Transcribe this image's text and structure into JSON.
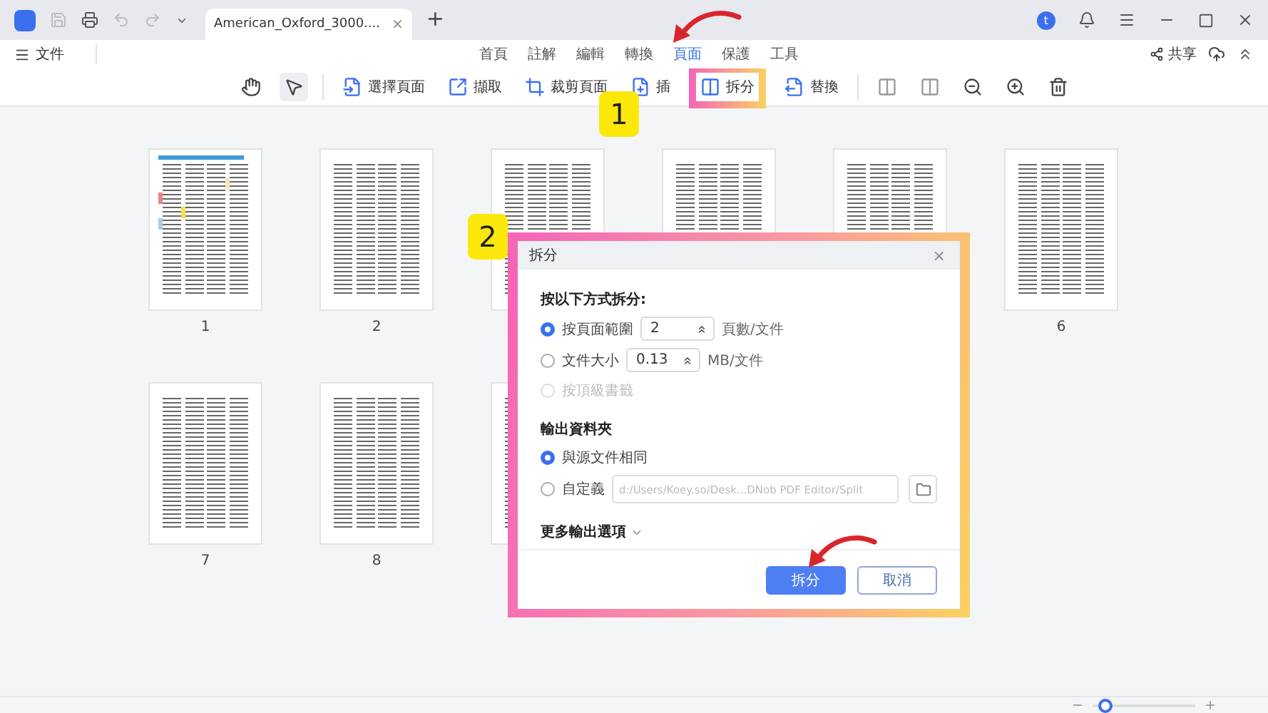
{
  "title_bar": {
    "avatar": "t",
    "tab": {
      "title": "American_Oxford_3000....",
      "close": "×"
    },
    "new_tab": "+"
  },
  "menu": {
    "file": "文件",
    "share": "共享"
  },
  "ribbon_tabs": [
    {
      "label": "首頁",
      "selected": false
    },
    {
      "label": "註解",
      "selected": false
    },
    {
      "label": "編輯",
      "selected": false
    },
    {
      "label": "轉換",
      "selected": false
    },
    {
      "label": "頁面",
      "selected": true
    },
    {
      "label": "保護",
      "selected": false
    },
    {
      "label": "工具",
      "selected": false
    }
  ],
  "toolbar": {
    "select_tool_selected": true,
    "buttons": [
      {
        "label": "選擇頁面",
        "highlighted": false
      },
      {
        "label": "擷取",
        "highlighted": false
      },
      {
        "label": "裁剪頁面",
        "highlighted": false
      },
      {
        "label": "插",
        "highlighted": false
      },
      {
        "label": "拆分",
        "highlighted": true
      },
      {
        "label": "替換",
        "highlighted": false
      }
    ]
  },
  "pages": [
    {
      "kind": "cover",
      "label": "1"
    },
    {
      "kind": "text",
      "label": "2"
    },
    {
      "kind": "text"
    },
    {
      "kind": "text"
    },
    {
      "kind": "text"
    },
    {
      "kind": "text",
      "label": "6"
    },
    {
      "kind": "text",
      "label": "7"
    },
    {
      "kind": "text",
      "label": "8"
    },
    {
      "kind": "text"
    }
  ],
  "dialog": {
    "title": "拆分",
    "close": "×",
    "split_heading": "按以下方式拆分:",
    "split_options": [
      {
        "label": "按頁面範圍",
        "selected": true,
        "disabled": false,
        "value": "2",
        "unit": "頁數/文件"
      },
      {
        "label": "文件大小",
        "selected": false,
        "disabled": false,
        "value": "0.13",
        "unit": "MB/文件"
      },
      {
        "label": "按頂級書籤",
        "selected": false,
        "disabled": true
      }
    ],
    "output_heading": "輸出資料夾",
    "output_options": [
      {
        "label": "與源文件相同",
        "selected": true
      },
      {
        "label": "自定義",
        "selected": false,
        "path": "d:/Users/Koey.so/Desk...DNob PDF Editor/Split"
      }
    ],
    "more_options": "更多輸出選項",
    "buttons": [
      {
        "label": "拆分",
        "kind": "primary"
      },
      {
        "label": "取消",
        "kind": "secondary"
      }
    ]
  },
  "callouts": [
    "1",
    "2"
  ],
  "zoom": {
    "level": 0.05
  }
}
